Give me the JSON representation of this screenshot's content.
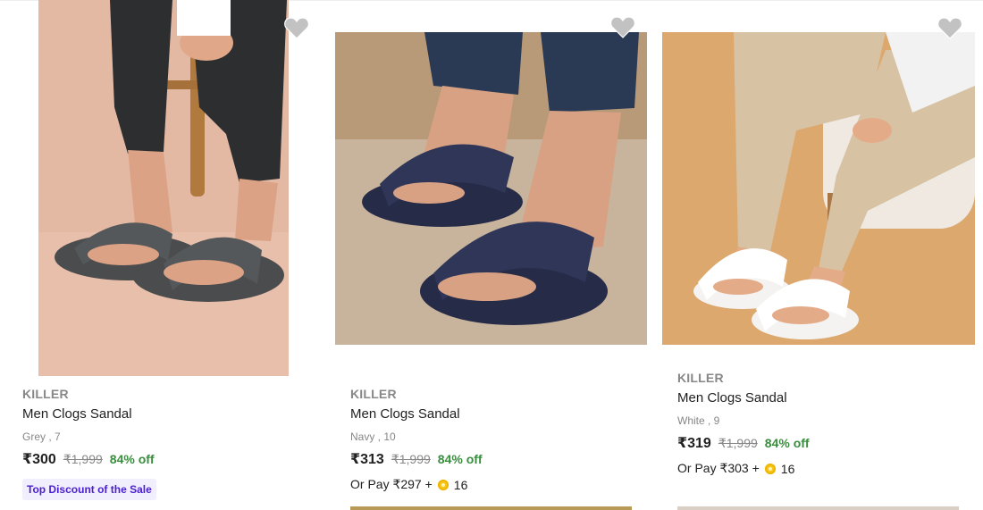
{
  "products": [
    {
      "brand": "KILLER",
      "title": "Men Clogs Sandal",
      "variant": "Grey , 7",
      "price": "₹300",
      "mrp": "₹1,999",
      "discount": "84% off",
      "badge": "Top Discount of the Sale",
      "image_bg": "#e9c1ad",
      "sandal_color": "#4a4c4d",
      "icon": "heart-icon"
    },
    {
      "brand": "KILLER",
      "title": "Men Clogs Sandal",
      "variant": "Navy , 10",
      "price": "₹313",
      "mrp": "₹1,999",
      "discount": "84% off",
      "pay_prefix": "Or Pay ₹297 +",
      "pay_coins": "16",
      "image_bg": "#c7b29b",
      "sandal_color": "#262c48",
      "icon": "heart-icon"
    },
    {
      "brand": "KILLER",
      "title": "Men Clogs Sandal",
      "variant": "White , 9",
      "price": "₹319",
      "mrp": "₹1,999",
      "discount": "84% off",
      "pay_prefix": "Or Pay ₹303 +",
      "pay_coins": "16",
      "image_bg": "#d9a66d",
      "sandal_color": "#f4f3f1",
      "icon": "heart-icon"
    }
  ],
  "colors": {
    "discount_green": "#388e3c",
    "muted_gray": "#878787",
    "badge_purple": "#4a1fd1",
    "coin_gold": "#f7c61a"
  }
}
